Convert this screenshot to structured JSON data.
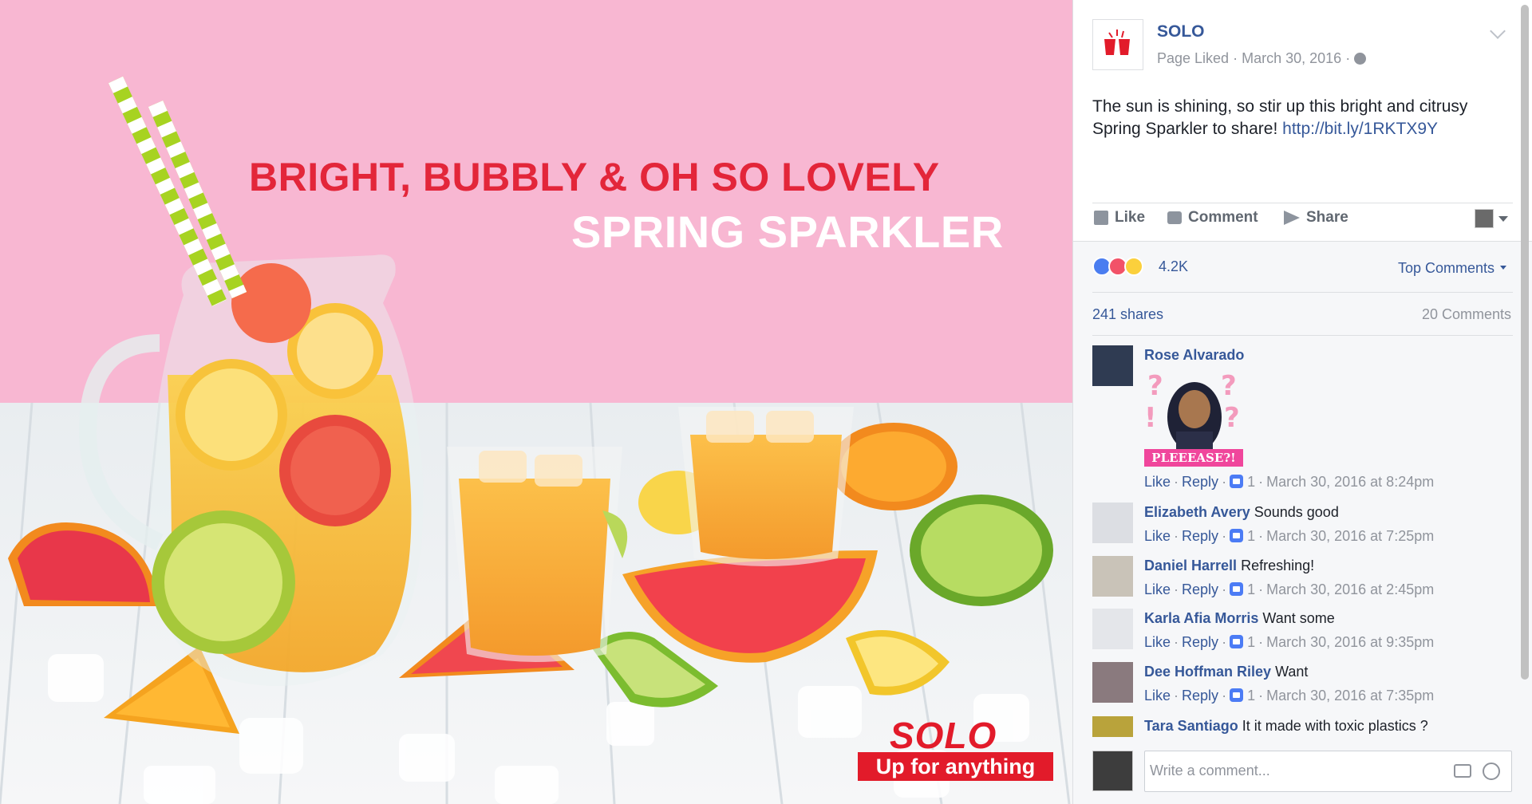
{
  "photo": {
    "headline_line1": "BRIGHT, BUBBLY & OH SO LOVELY",
    "headline_line2": "SPRING SPARKLER",
    "brand_logo": "SOLO",
    "brand_tagline": "Up for anything",
    "colors": {
      "background_pink": "#f8b7d2",
      "table_white": "#eef1f3",
      "headline_red": "#e3263a",
      "logo_red": "#e21b2a"
    }
  },
  "post": {
    "page_name": "SOLO",
    "page_liked": "Page Liked",
    "date": "March 30, 2016",
    "privacy_icon": "globe-icon",
    "text": "The sun is shining, so stir up this bright and citrusy Spring Sparkler to share!",
    "link": "http://bit.ly/1RKTX9Y"
  },
  "actions": {
    "like": "Like",
    "comment": "Comment",
    "share": "Share"
  },
  "reactions": {
    "count": "4.2K",
    "types": [
      "like",
      "love",
      "wow"
    ],
    "sort": "Top Comments"
  },
  "stats": {
    "shares": "241 shares",
    "comments": "20 Comments"
  },
  "comments": [
    {
      "author": "Rose Alvarado",
      "text": "",
      "sticker_text": "PLEEEASE?!",
      "like": "Like",
      "reply": "Reply",
      "likes": "1",
      "time": "March 30, 2016 at 8:24pm"
    },
    {
      "author": "Elizabeth Avery",
      "text": "Sounds good",
      "like": "Like",
      "reply": "Reply",
      "likes": "1",
      "time": "March 30, 2016 at 7:25pm"
    },
    {
      "author": "Daniel Harrell",
      "text": "Refreshing!",
      "like": "Like",
      "reply": "Reply",
      "likes": "1",
      "time": "March 30, 2016 at 2:45pm"
    },
    {
      "author": "Karla Afia Morris",
      "text": "Want some",
      "like": "Like",
      "reply": "Reply",
      "likes": "1",
      "time": "March 30, 2016 at 9:35pm"
    },
    {
      "author": "Dee Hoffman Riley",
      "text": "Want",
      "like": "Like",
      "reply": "Reply",
      "likes": "1",
      "time": "March 30, 2016 at 7:35pm"
    },
    {
      "author": "Tara Santiago",
      "text": "It it made with toxic plastics ?"
    }
  ],
  "composer": {
    "placeholder": "Write a comment..."
  }
}
